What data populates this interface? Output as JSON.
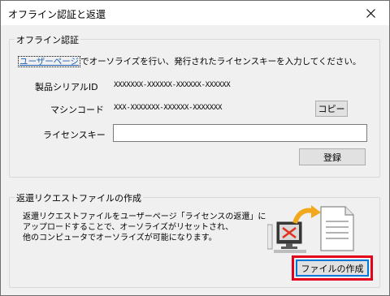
{
  "window": {
    "title": "オフライン認証と返還"
  },
  "offline_auth": {
    "legend": "オフライン認証",
    "link_text": "ユーザーページ",
    "instruction": "でオーソライズを行い、発行されたライセンスキーを入力してください。",
    "serial_label": "製品シリアルID",
    "serial_value": "XXXXXXX-XXXXXX-XXXXXX-XXXXXX",
    "machine_label": "マシンコード",
    "machine_value": "XXX-XXXXXXX-XXXXXX-XXXXXXX",
    "copy_button": "コピー",
    "license_label": "ライセンスキー",
    "license_value": "",
    "register_button": "登録"
  },
  "return_request": {
    "legend": "返還リクエストファイルの作成",
    "description_lines": [
      "返還リクエストファイルをユーザーページ「ライセンスの返還」に",
      "アップロードすることで、オーソライズがリセットされ、",
      "他のコンピュータでオーソライズが可能になります。"
    ],
    "create_button": "ファイルの作成"
  },
  "colors": {
    "highlight": "#e3001b",
    "link": "#1a5fb4",
    "arrow": "#f2a81d"
  },
  "icons": {
    "close": "close-icon",
    "illustration": "computer-to-document-icon"
  }
}
